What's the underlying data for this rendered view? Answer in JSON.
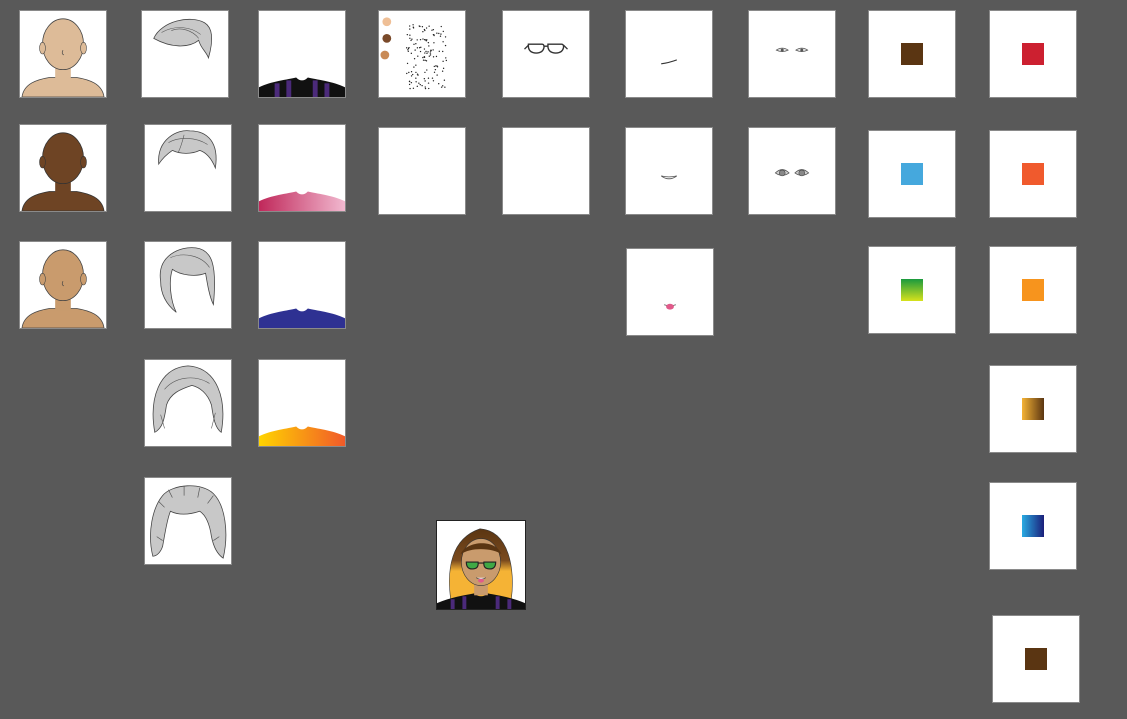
{
  "avatar_builder": {
    "skin_options": [
      {
        "name": "light-skin",
        "color": "#ddbb98"
      },
      {
        "name": "dark-skin",
        "color": "#6e4424"
      },
      {
        "name": "tan-skin",
        "color": "#c99b6d"
      }
    ],
    "hair_styles": [
      "swept-short",
      "short-parted",
      "side-swept-long",
      "bob",
      "messy-long"
    ],
    "shirt_options": [
      {
        "name": "black-purple-striped",
        "colors": [
          "#111111",
          "#4b2a7a"
        ]
      },
      {
        "name": "pink-gradient",
        "colors": [
          "#c0285a",
          "#f1b8cf"
        ]
      },
      {
        "name": "navy",
        "colors": [
          "#2e3192"
        ]
      },
      {
        "name": "yellow-orange-gradient",
        "colors": [
          "#ffd400",
          "#f15a29"
        ]
      }
    ],
    "freckle_options": [
      "freckles",
      "none"
    ],
    "freckle_color_dots": [
      "#efbf96",
      "#7a4a2a",
      "#c98a55"
    ],
    "glasses_options": [
      "round-glasses",
      "none"
    ],
    "mouth_options": [
      "smirk",
      "smile",
      "tongue-out"
    ],
    "eye_options": [
      "narrow-eyes",
      "round-eyes"
    ],
    "eye_color_swatches": [
      {
        "name": "brown",
        "color": "#5a3512"
      },
      {
        "name": "blue",
        "color": "#45a8dd"
      },
      {
        "name": "green-gradient",
        "colors": [
          "#1a9a3e",
          "#d7e21c"
        ]
      }
    ],
    "hair_color_swatches": [
      {
        "name": "red",
        "color": "#cc2030"
      },
      {
        "name": "orange-red",
        "color": "#f05a2d"
      },
      {
        "name": "orange",
        "color": "#f7941d"
      },
      {
        "name": "ombre-yellow-brown",
        "colors": [
          "#f5b335",
          "#5a3512"
        ]
      },
      {
        "name": "blue-gradient",
        "colors": [
          "#29abe2",
          "#1b1f7a"
        ]
      }
    ],
    "extra_swatch": {
      "name": "brown",
      "color": "#5a3512"
    },
    "preview": {
      "skin": "#c99b6d",
      "hair_top": "#5a3512",
      "hair_bottom": "#f5b335",
      "eyes": "#3fa845",
      "shirt": "#111111",
      "stripe": "#4b2a7a"
    }
  }
}
